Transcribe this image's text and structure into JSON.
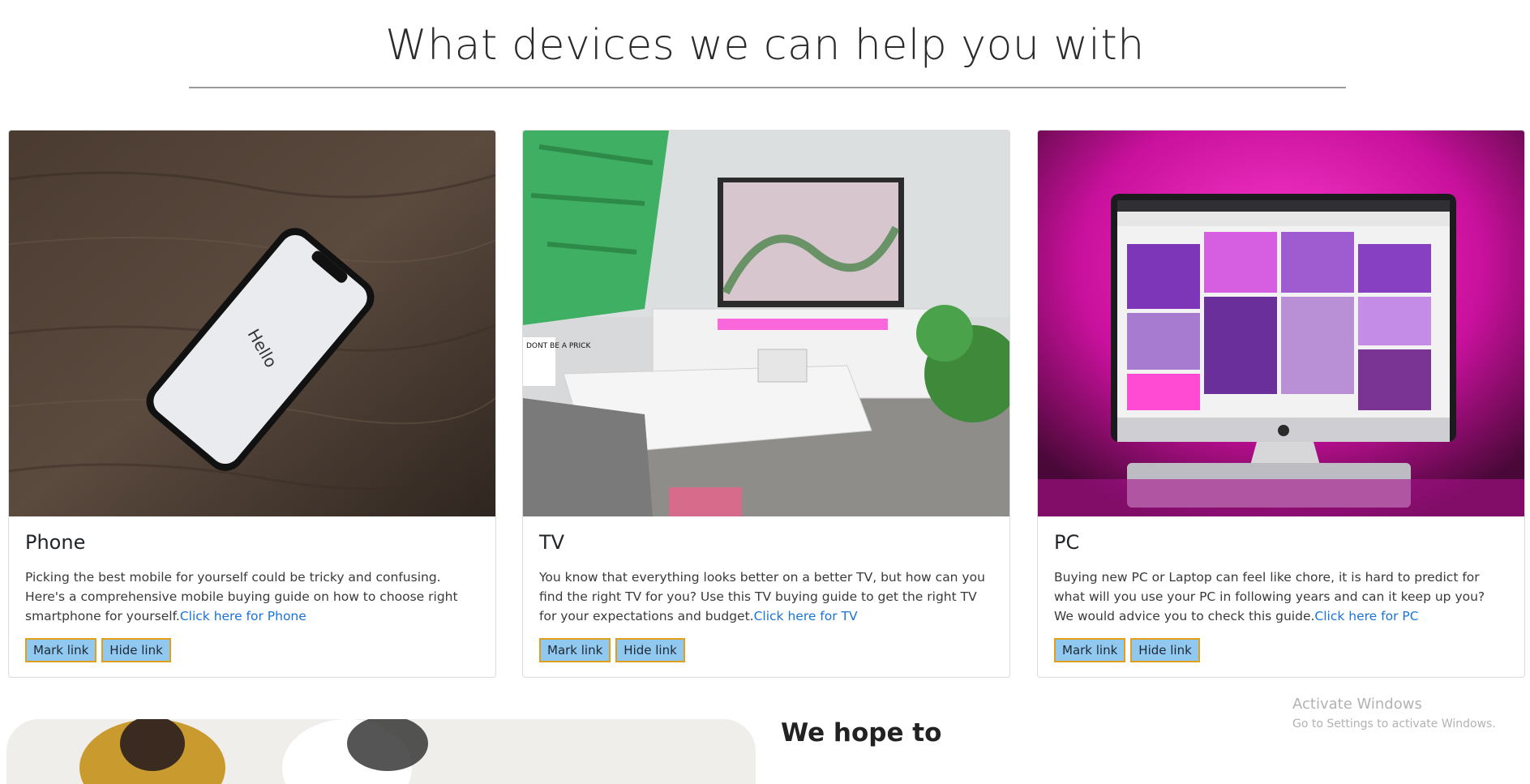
{
  "section": {
    "title": "What devices we can help you with"
  },
  "cards": [
    {
      "title": "Phone",
      "text": "Picking the best mobile for yourself could be tricky and confusing. Here's a comprehensive mobile buying guide on how to choose right smartphone for yourself.",
      "link": "Click here for Phone",
      "image_text": "Hello",
      "mark_label": "Mark link",
      "hide_label": "Hide link"
    },
    {
      "title": "TV",
      "text": "You know that everything looks better on a better TV, but how can you find the right TV for you? Use this TV buying guide to get the right TV for your expectations and budget.",
      "link": "Click here for TV",
      "image_text": "DONT BE A PRICK",
      "mark_label": "Mark link",
      "hide_label": "Hide link"
    },
    {
      "title": "PC",
      "text": "Buying new PC or Laptop can feel like chore, it is hard to predict for what will you use your PC in following years and can it keep up you? We would advice you to check this guide.",
      "link": "Click here for PC",
      "mark_label": "Mark link",
      "hide_label": "Hide link"
    }
  ],
  "next_section": {
    "title": "We hope to"
  },
  "watermark": {
    "line1": "Activate Windows",
    "line2": "Go to Settings to activate Windows."
  },
  "colors": {
    "link": "#1a73d9",
    "button_bg": "#90c8f0",
    "button_border": "#e0a01b"
  }
}
